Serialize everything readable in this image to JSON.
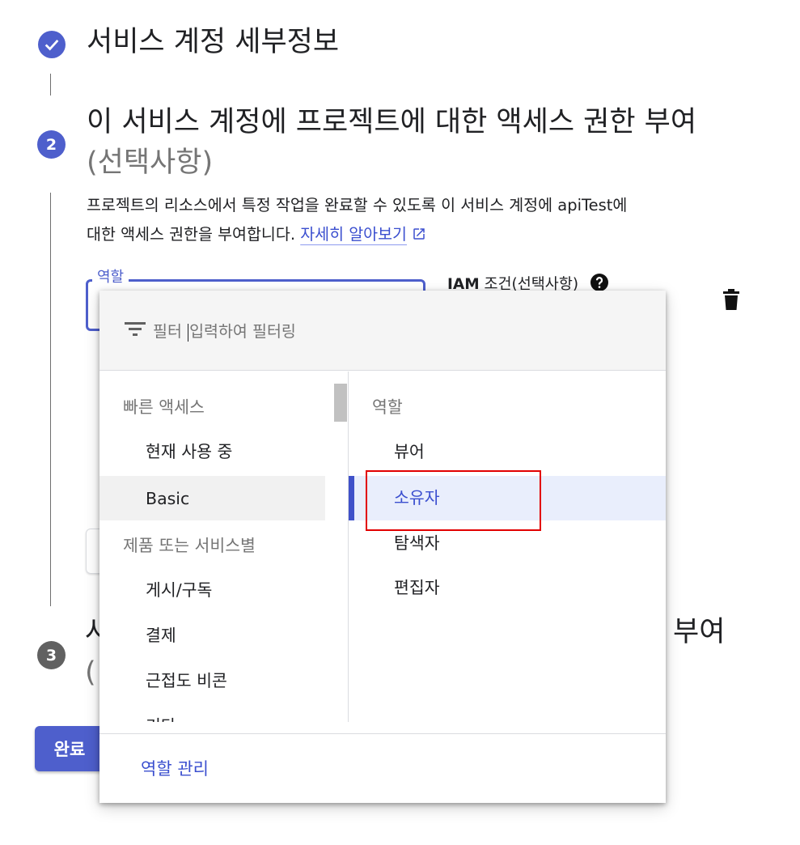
{
  "stepper": {
    "step1": {
      "title": "서비스 계정 세부정보",
      "icon": "check-icon"
    },
    "step2": {
      "number": "2",
      "title": "이 서비스 계정에 프로젝트에 대한 액세스 권한 부여",
      "optional": "(선택사항)",
      "description_line1": "프로젝트의 리소스에서 특정 작업을 완료할 수 있도록 이 서비스 계정에 apiTest에",
      "description_line2": "대한 액세스 권한을 부여합니다.",
      "learn_more": "자세히 알아보기"
    },
    "step3": {
      "number": "3",
      "title_start": "사",
      "title_end": "부여",
      "optional_start": "("
    }
  },
  "role_field": {
    "label": "역할"
  },
  "iam_condition": {
    "label_bold": "IAM",
    "label_rest": " 조건(선택사항)"
  },
  "done_button": {
    "label": "완료"
  },
  "dropdown": {
    "filter": {
      "label": "필터",
      "placeholder": "입력하여 필터링"
    },
    "categories": {
      "quick_access_header": "빠른 액세스",
      "items": [
        "현재 사용 중",
        "Basic"
      ],
      "by_product_header": "제품 또는 서비스별",
      "product_items": [
        "게시/구독",
        "결제",
        "근접도 비콘",
        "기타"
      ],
      "selected": "Basic"
    },
    "roles": {
      "header": "역할",
      "items": [
        "뷰어",
        "소유자",
        "탐색자",
        "편집자"
      ],
      "selected": "소유자"
    },
    "manage_roles": "역할 관리"
  },
  "colors": {
    "primary": "#4e5fcc",
    "link": "#3b4fcf",
    "highlight": "#e20000",
    "selected_bg": "#e9eefc"
  }
}
